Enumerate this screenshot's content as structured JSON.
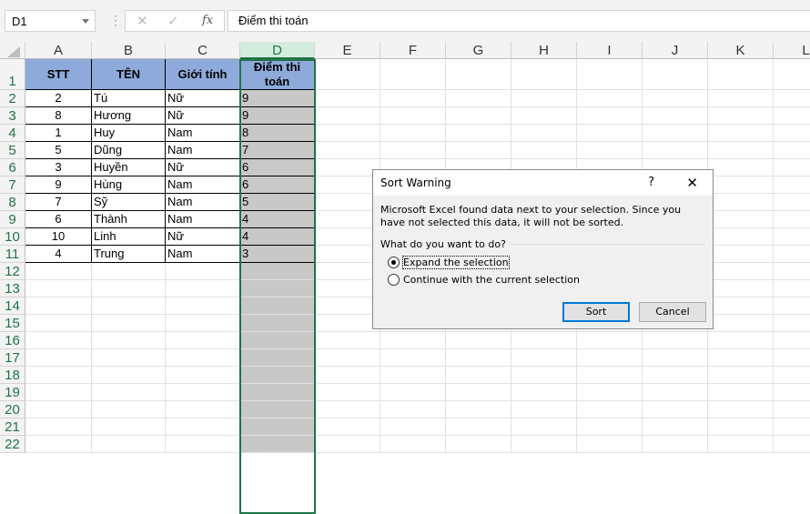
{
  "name_box": "D1",
  "formula": "Điểm thi toán",
  "columns": [
    "A",
    "B",
    "C",
    "D",
    "E",
    "F",
    "G",
    "H",
    "I",
    "J",
    "K",
    "L"
  ],
  "rows": [
    "1",
    "2",
    "3",
    "4",
    "5",
    "6",
    "7",
    "8",
    "9",
    "10",
    "11",
    "12",
    "13",
    "14",
    "15",
    "16",
    "17",
    "18",
    "19",
    "20",
    "21",
    "22"
  ],
  "headers": [
    "STT",
    "TÊN",
    "Giới tính",
    "Điểm thi toán"
  ],
  "table": [
    [
      "2",
      "Tú",
      "Nữ",
      "9"
    ],
    [
      "8",
      "Hương",
      "Nữ",
      "9"
    ],
    [
      "1",
      "Huy",
      "Nam",
      "8"
    ],
    [
      "5",
      "Dũng",
      "Nam",
      "7"
    ],
    [
      "3",
      "Huyền",
      "Nữ",
      "6"
    ],
    [
      "9",
      "Hùng",
      "Nam",
      "6"
    ],
    [
      "7",
      "Sỹ",
      "Nam",
      "5"
    ],
    [
      "6",
      "Thành",
      "Nam",
      "4"
    ],
    [
      "10",
      "Linh",
      "Nữ",
      "4"
    ],
    [
      "4",
      "Trung",
      "Nam",
      "3"
    ]
  ],
  "colors": {
    "header_fill": "#8eaadb",
    "selection": "#217346",
    "selected_fill": "#c8c8c8"
  },
  "dialog": {
    "title": "Sort Warning",
    "help": "?",
    "close": "✕",
    "message": "Microsoft Excel found data next to your selection.  Since you have not selected this data, it will not be sorted.",
    "question": "What do you want to do?",
    "options": [
      {
        "label": "Expand the selection",
        "selected": true
      },
      {
        "label": "Continue with the current selection",
        "selected": false
      }
    ],
    "sort_label": "Sort",
    "cancel_label": "Cancel"
  }
}
